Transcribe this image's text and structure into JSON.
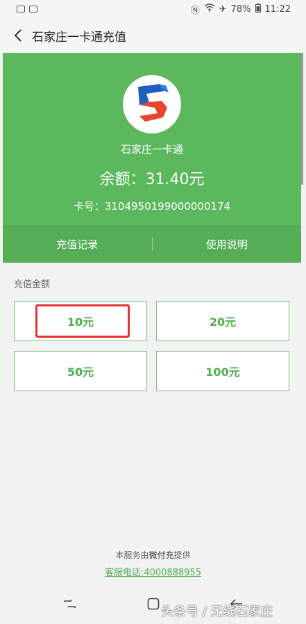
{
  "status_bar": {
    "battery": "78%",
    "time": "11:22"
  },
  "header": {
    "title": "石家庄一卡通充值"
  },
  "card": {
    "name": "石家庄一卡通",
    "balance": "余额：31.40元",
    "card_number": "卡号：3104950199000000174",
    "tabs": [
      {
        "label": "充值记录"
      },
      {
        "label": "使用说明"
      }
    ]
  },
  "recharge": {
    "label": "充值金额",
    "amounts": [
      "10元",
      "20元",
      "50元",
      "100元"
    ]
  },
  "footer": {
    "provider_prefix": "本服务由",
    "provider_name": "微付充",
    "provider_suffix": "提供",
    "hotline": "客服电话:4000888955"
  },
  "watermark": "头条号 / 无线石家庄",
  "colors": {
    "primary_green": "#5cb85c",
    "tab_green": "#55ad55",
    "button_text": "#4caf50",
    "highlight_red": "#e5322d"
  }
}
